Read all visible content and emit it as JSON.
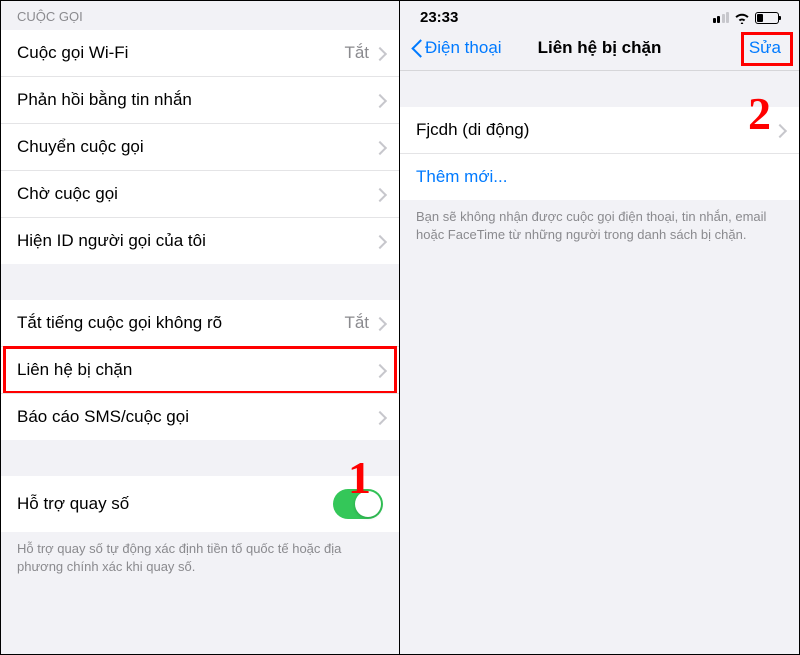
{
  "left": {
    "section_header": "CUỘC GỌI",
    "rows1": [
      {
        "label": "Cuộc gọi Wi-Fi",
        "value": "Tắt"
      },
      {
        "label": "Phản hồi bằng tin nhắn"
      },
      {
        "label": "Chuyển cuộc gọi"
      },
      {
        "label": "Chờ cuộc gọi"
      },
      {
        "label": "Hiện ID người gọi của tôi"
      }
    ],
    "rows2": [
      {
        "label": "Tắt tiếng cuộc gọi không rõ",
        "value": "Tắt"
      },
      {
        "label": "Liên hệ bị chặn",
        "highlight": true
      },
      {
        "label": "Báo cáo SMS/cuộc gọi"
      }
    ],
    "rows3": [
      {
        "label": "Hỗ trợ quay số",
        "toggle": true
      }
    ],
    "footer": "Hỗ trợ quay số tự động xác định tiền tố quốc tế hoặc địa phương chính xác khi quay số.",
    "callout": "1"
  },
  "right": {
    "time": "23:33",
    "nav_back": "Điện thoại",
    "nav_title": "Liên hệ bị chặn",
    "nav_edit": "Sửa",
    "contact": "Fjcdh (di động)",
    "add_new": "Thêm mới...",
    "footer": "Bạn sẽ không nhận được cuộc gọi điện thoại, tin nhắn, email hoặc FaceTime từ những người trong danh sách bị chặn.",
    "callout": "2"
  }
}
